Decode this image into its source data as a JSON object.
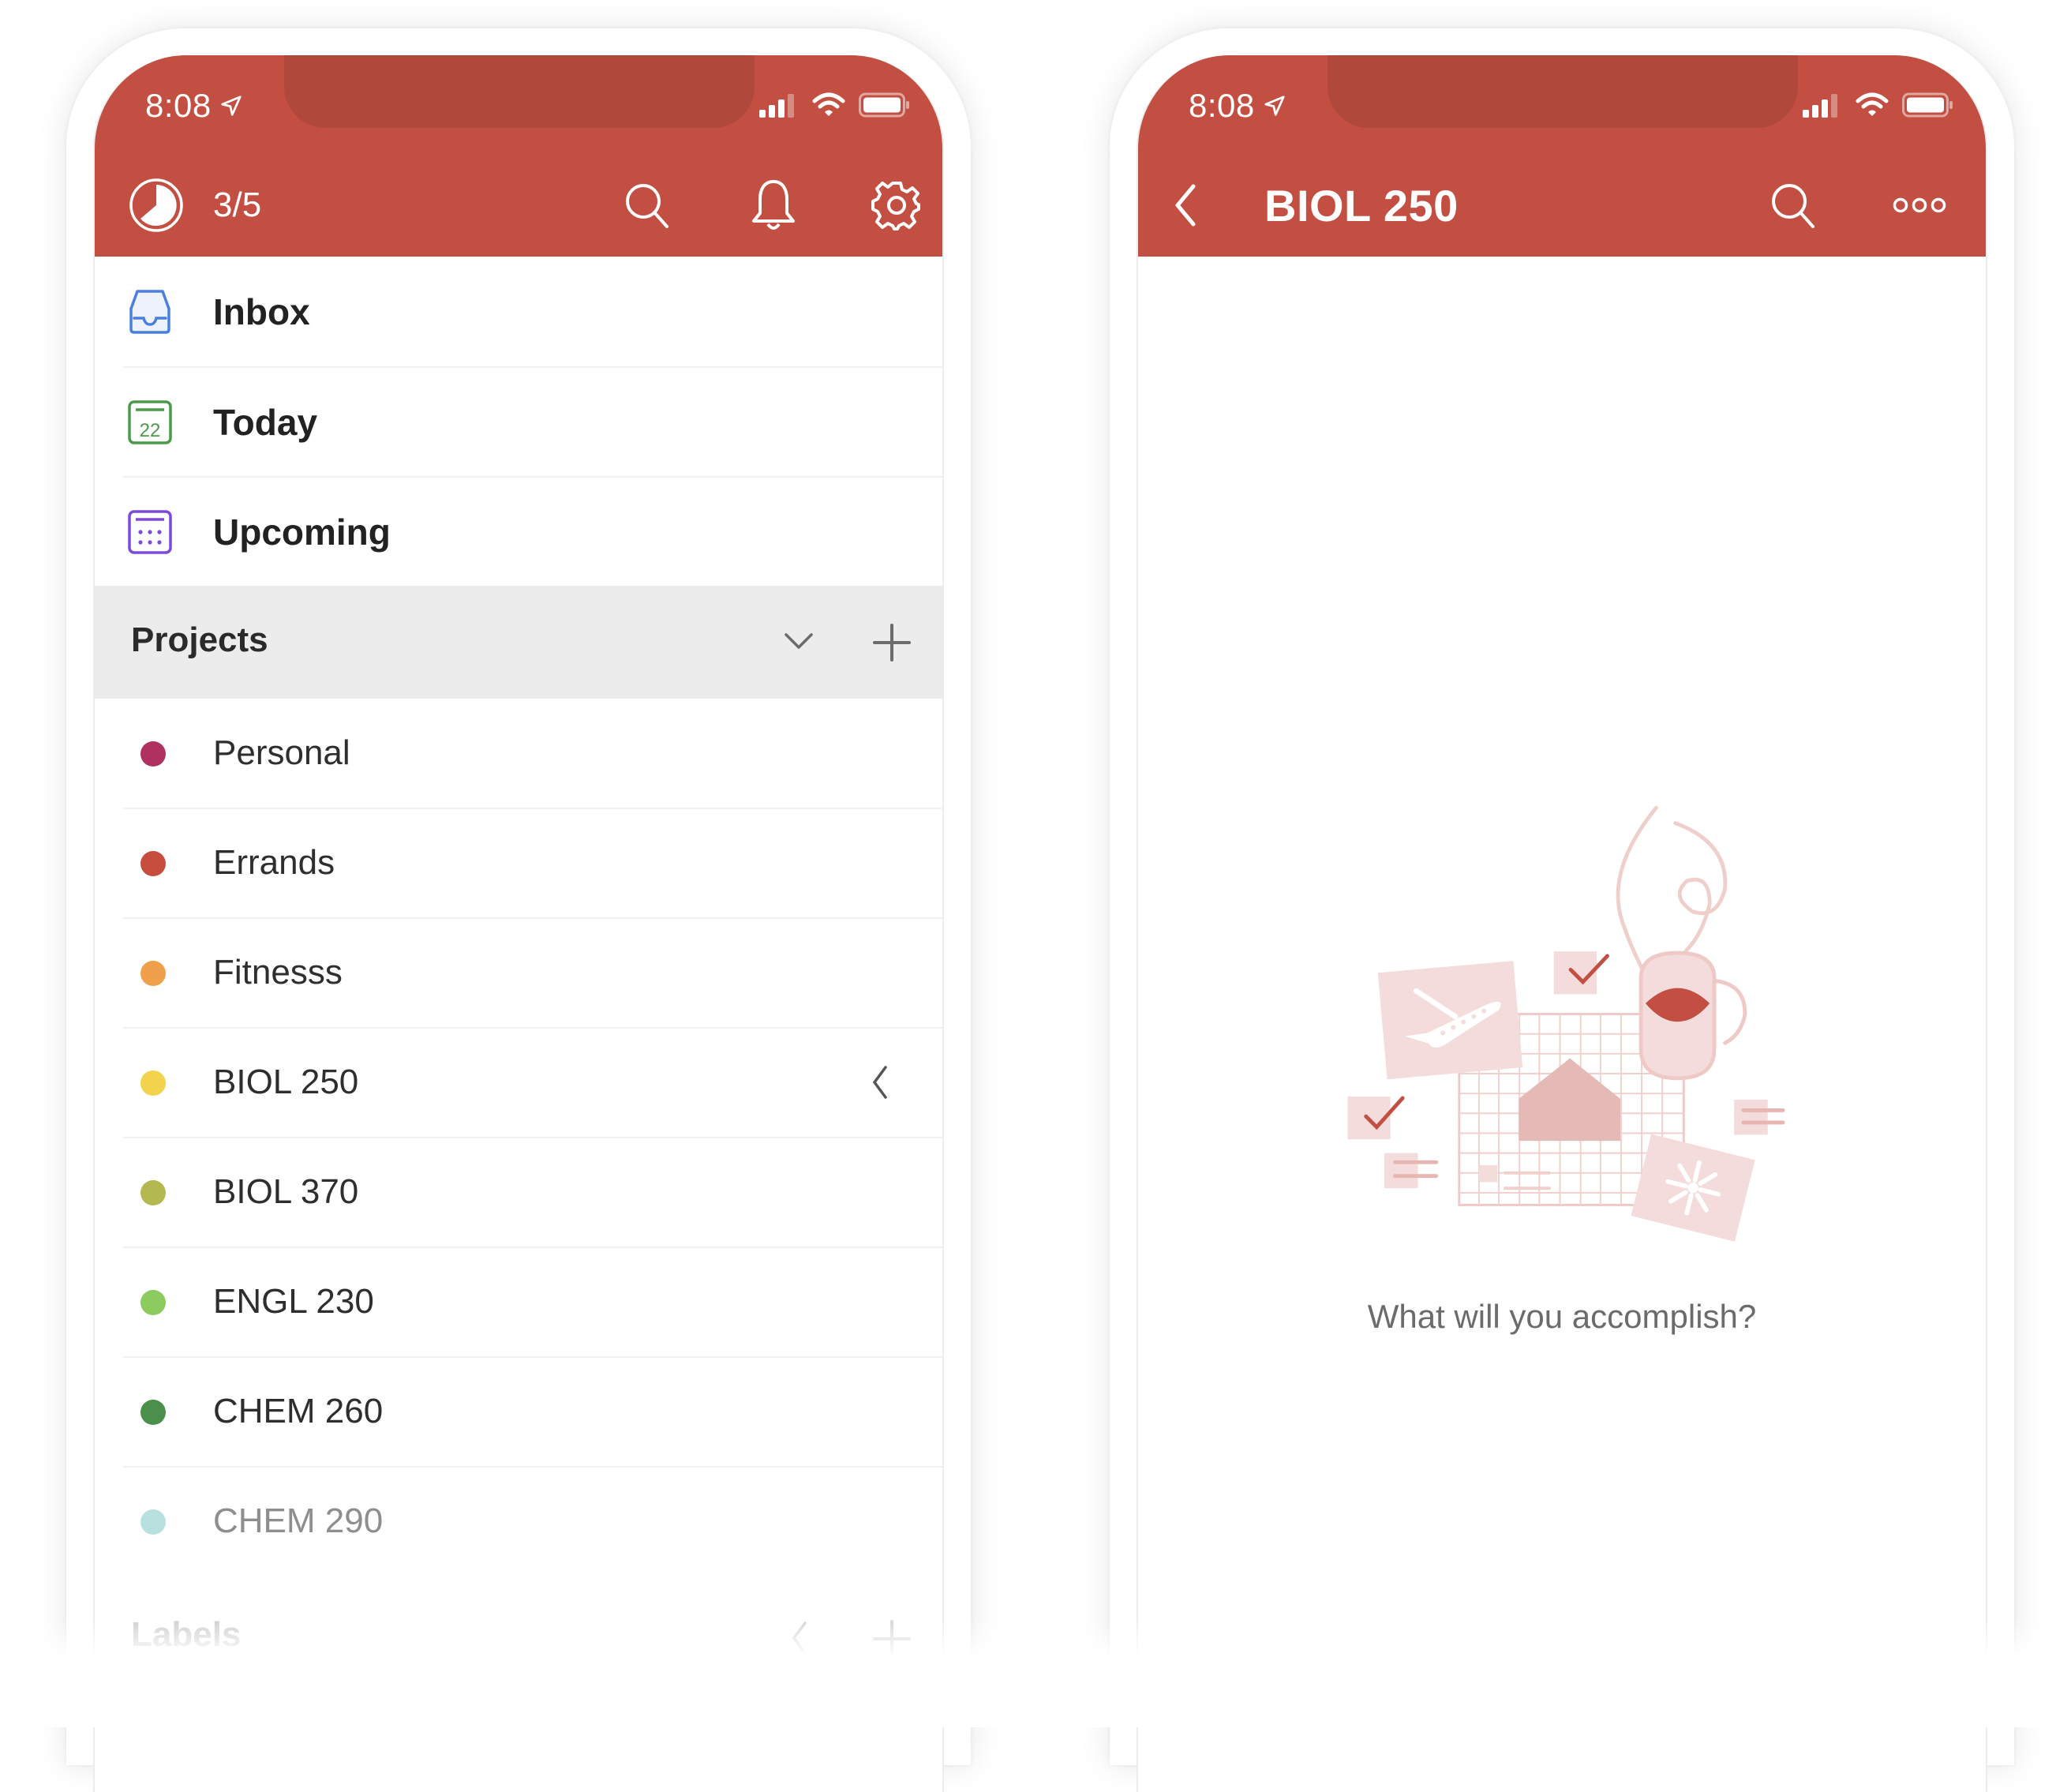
{
  "colors": {
    "brand_red": "#c24f41",
    "notch": "#b0483b",
    "inbox_blue": "#4a7fe0",
    "today_green": "#4b9a4a",
    "upcoming_purple": "#7b4bd6"
  },
  "left_phone": {
    "status_bar": {
      "time": "8:08",
      "location_icon": "location-arrow-icon",
      "signal_bars_filled": 3,
      "signal_bars_total": 4,
      "wifi_icon": "wifi-icon",
      "battery_icon": "battery-full-icon"
    },
    "toolbar": {
      "karma_icon": "productivity-pie-icon",
      "karma_progress": "3/5",
      "search_icon": "search-icon",
      "notifications_icon": "bell-icon",
      "settings_icon": "gear-icon"
    },
    "nav": [
      {
        "label": "Inbox",
        "icon": "inbox-tray-icon"
      },
      {
        "label": "Today",
        "icon": "calendar-today-icon",
        "icon_text": "22"
      },
      {
        "label": "Upcoming",
        "icon": "calendar-upcoming-icon"
      }
    ],
    "projects_header": {
      "label": "Projects",
      "collapse_icon": "chevron-down-icon",
      "add_icon": "plus-icon"
    },
    "projects": [
      {
        "label": "Personal",
        "color": "#b0305f"
      },
      {
        "label": "Errands",
        "color": "#c74d3e"
      },
      {
        "label": "Fitnesss",
        "color": "#f0a04b"
      },
      {
        "label": "BIOL 250",
        "color": "#f3d24d",
        "action_icon": "chevron-left-icon"
      },
      {
        "label": "BIOL 370",
        "color": "#b3b850"
      },
      {
        "label": "ENGL 230",
        "color": "#8ccb5e"
      },
      {
        "label": "CHEM 260",
        "color": "#4a8f4a"
      },
      {
        "label": "CHEM 290",
        "color": "#b8e0df"
      }
    ],
    "labels_header": {
      "label": "Labels",
      "collapse_icon": "chevron-left-icon",
      "add_icon": "plus-icon"
    }
  },
  "right_phone": {
    "status_bar": {
      "time": "8:08"
    },
    "toolbar": {
      "back_icon": "chevron-left-icon",
      "title": "BIOL 250",
      "search_icon": "search-icon",
      "more_icon": "more-dots-icon"
    },
    "empty_state": {
      "illustration": "empty-project-illustration",
      "message": "What will you accomplish?"
    }
  }
}
